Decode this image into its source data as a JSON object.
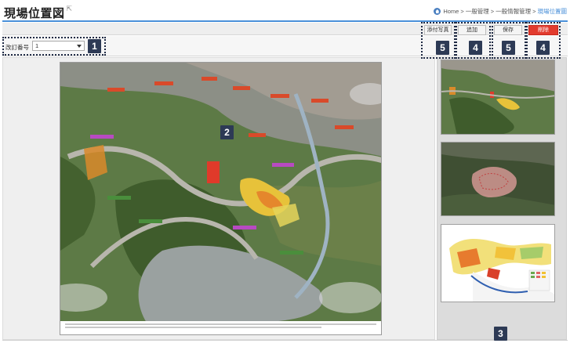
{
  "page": {
    "title": "現場位置図",
    "title_icon": "external-link-icon"
  },
  "breadcrumb": {
    "home": "Home",
    "items": [
      "一般管理",
      "一般情報管理"
    ],
    "current": "現場位置圖",
    "separator": ">"
  },
  "toolbar": {
    "attach_photo": "添付写真",
    "add": "追加",
    "save": "保存",
    "delete": "削除"
  },
  "filter": {
    "label": "改訂番号",
    "selected": "1"
  },
  "markers": {
    "m1": "1",
    "m2": "2",
    "m3": "3",
    "m4a": "4",
    "m4b": "4",
    "m5a": "5",
    "m5b": "5"
  },
  "colors": {
    "accent": "#4a90d9",
    "danger": "#e23b2e",
    "marker_bg": "#2d3a55"
  },
  "thumbnails": [
    {
      "name": "aerial-thumbnail"
    },
    {
      "name": "site-boundary-thumbnail"
    },
    {
      "name": "land-use-plan-thumbnail"
    }
  ]
}
